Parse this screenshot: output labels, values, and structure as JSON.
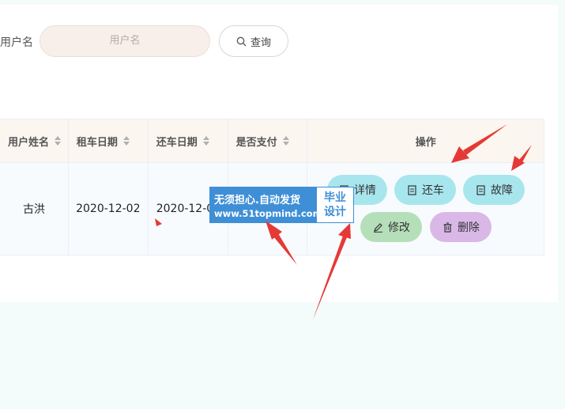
{
  "search": {
    "label": "用户名",
    "placeholder": "用户名",
    "button_label": "查询"
  },
  "table": {
    "headers": [
      "用户姓名",
      "租车日期",
      "还车日期",
      "是否支付",
      "操作"
    ],
    "rows": [
      {
        "user_name": "古洪",
        "rent_date": "2020-12-02",
        "return_date": "2020-12-0",
        "paid": ""
      }
    ]
  },
  "actions": {
    "detail": "详情",
    "return_car": "还车",
    "fault": "故障",
    "edit": "修改",
    "delete": "删除"
  },
  "watermark": {
    "line1": "无须担心.自动发货",
    "line2": "www.51topmind.com",
    "right_line1": "毕业",
    "right_line2": "设计"
  },
  "colors": {
    "page_background": "#f3fbfb",
    "annotation_arrow": "#e53935",
    "action_blue": "#a8e6ee",
    "action_green": "#b5dfb9",
    "action_purple": "#d9b8e8",
    "watermark_blue": "#3f8fd6"
  }
}
